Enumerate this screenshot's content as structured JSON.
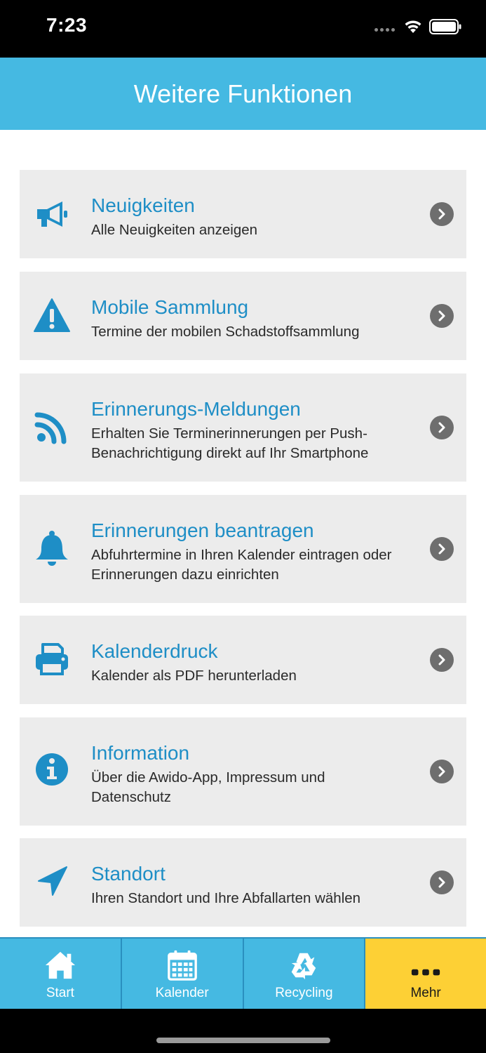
{
  "status": {
    "time": "7:23"
  },
  "header": {
    "title": "Weitere Funktionen"
  },
  "menu": [
    {
      "icon": "megaphone-icon",
      "title": "Neuigkeiten",
      "subtitle": "Alle Neuigkeiten anzeigen"
    },
    {
      "icon": "warning-icon",
      "title": "Mobile Sammlung",
      "subtitle": "Termine der mobilen Schadstoffsammlung"
    },
    {
      "icon": "rss-icon",
      "title": "Erinnerungs-Meldungen",
      "subtitle": "Erhalten Sie Terminerinnerungen per Push-Benachrichtigung direkt auf Ihr Smartphone"
    },
    {
      "icon": "bell-icon",
      "title": "Erinnerungen beantragen",
      "subtitle": "Abfuhrtermine in Ihren Kalender eintragen oder Erinnerungen dazu einrichten"
    },
    {
      "icon": "printer-icon",
      "title": "Kalenderdruck",
      "subtitle": "Kalender als PDF herunterladen"
    },
    {
      "icon": "info-icon",
      "title": "Information",
      "subtitle": "Über die Awido-App, Impressum und Datenschutz"
    },
    {
      "icon": "location-arrow-icon",
      "title": "Standort",
      "subtitle": "Ihren Standort und Ihre Abfallarten wählen"
    }
  ],
  "tabs": [
    {
      "icon": "home-icon",
      "label": "Start"
    },
    {
      "icon": "calendar-icon",
      "label": "Kalender"
    },
    {
      "icon": "recycle-icon",
      "label": "Recycling"
    },
    {
      "icon": "more-icon",
      "label": "Mehr",
      "active": true
    }
  ],
  "colors": {
    "accent": "#45b9e2",
    "title_blue": "#1e8ec6",
    "active_tab": "#fdd035",
    "row_bg": "#ececec"
  }
}
